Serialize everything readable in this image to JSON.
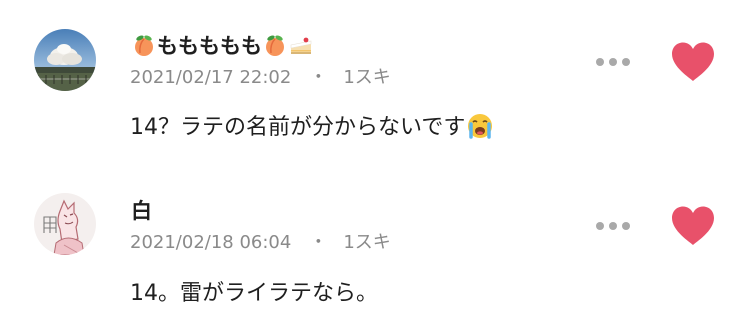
{
  "comments": [
    {
      "author_prefix_icon": "peach-emoji-icon",
      "author_text": "ももももも",
      "author_suffix_icons": [
        "peach-emoji-icon",
        "cake-slice-emoji-icon"
      ],
      "date": "2021/02/17 22:02",
      "separator": "・",
      "likes": "1スキ",
      "text": "14？ラテの名前が分からないです",
      "text_suffix_icon": "loudly-crying-face-emoji-icon",
      "liked": true
    },
    {
      "author_text": "白",
      "date": "2021/02/18 06:04",
      "separator": "・",
      "likes": "1スキ",
      "text": "14。雷がライラテなら。",
      "liked": true
    }
  ],
  "colors": {
    "heart": "#e8516a",
    "meta_gray": "#8a8a8a",
    "dots_gray": "#a9a9a9",
    "text": "#1f1f1f"
  }
}
